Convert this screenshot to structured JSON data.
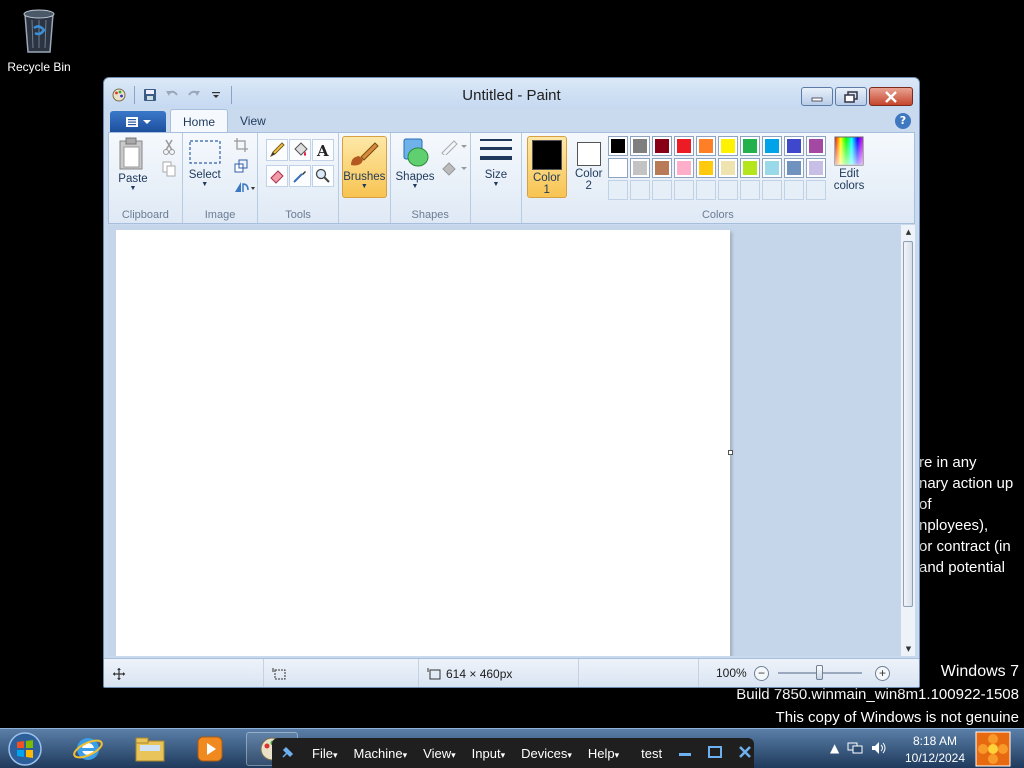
{
  "desktop": {
    "recycle_bin_label": "Recycle Bin",
    "background_text": [
      "re in any",
      "nary action up",
      "of",
      "nployees),",
      " or contract (in",
      "and potential"
    ]
  },
  "watermark": {
    "line1": "Windows 7",
    "line2": "Build 7850.winmain_win8m1.100922-1508",
    "line3": "This copy of Windows is not genuine"
  },
  "window": {
    "title": "Untitled - Paint",
    "tabs": [
      {
        "label": "Home",
        "active": true
      },
      {
        "label": "View",
        "active": false
      }
    ],
    "help_icon": "help-icon"
  },
  "ribbon": {
    "clipboard": {
      "label": "Clipboard",
      "paste_label": "Paste"
    },
    "image": {
      "label": "Image",
      "select_label": "Select"
    },
    "tools": {
      "label": "Tools"
    },
    "brushes": {
      "label": "Brushes"
    },
    "shapes": {
      "label": "Shapes",
      "shapes_label": "Shapes"
    },
    "size": {
      "label": "Size"
    },
    "colors": {
      "label": "Colors",
      "color1_label": "Color",
      "color1_num": "1",
      "color2_label": "Color",
      "color2_num": "2",
      "edit_colors_label1": "Edit",
      "edit_colors_label2": "colors",
      "color1_value": "#000000",
      "color2_value": "#ffffff",
      "palette_row1": [
        "#000000",
        "#7f7f7f",
        "#880015",
        "#ed1c24",
        "#ff7f27",
        "#fff200",
        "#22b14c",
        "#00a2e8",
        "#3f48cc",
        "#a349a4"
      ],
      "palette_row2": [
        "#ffffff",
        "#c3c3c3",
        "#b97a57",
        "#ffaec9",
        "#ffc90e",
        "#efe4b0",
        "#b5e61d",
        "#99d9ea",
        "#7092be",
        "#c8bfe7"
      ]
    }
  },
  "statusbar": {
    "image_size": "614 × 460px",
    "zoom": "100%",
    "zoom_fraction": 0.5
  },
  "taskbar": {
    "time": "8:18 AM",
    "date": "10/12/2024"
  },
  "vmbar": {
    "items": [
      "File",
      "Machine",
      "View",
      "Input",
      "Devices",
      "Help"
    ],
    "name": "test"
  }
}
